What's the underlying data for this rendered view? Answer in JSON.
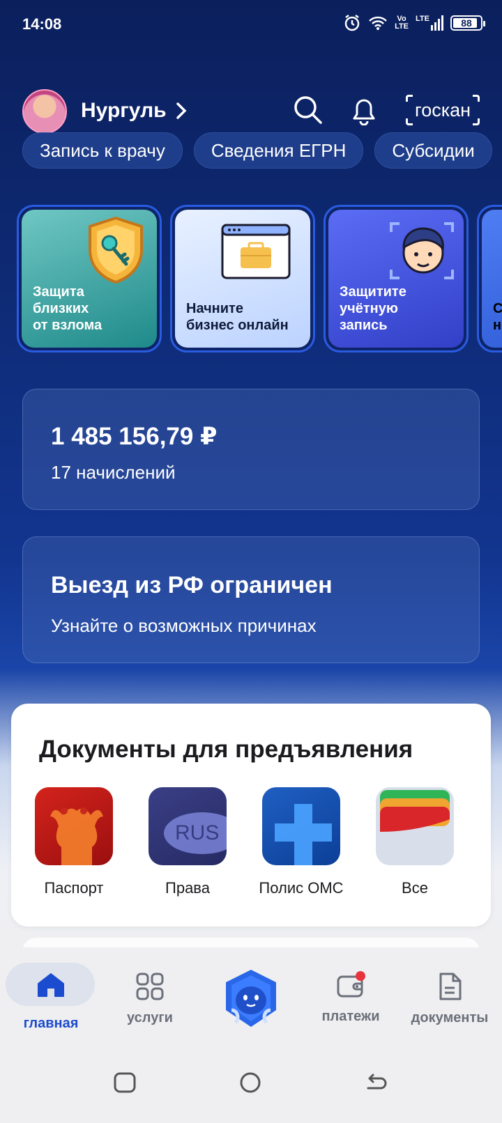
{
  "status_bar": {
    "time": "14:08",
    "net_label_1": "Vo\nLTE",
    "net_label_2": "LTE",
    "battery": "88"
  },
  "header": {
    "user_name": "Нургуль",
    "scan_label": "госкан"
  },
  "chips": [
    "Запись к врачу",
    "Сведения ЕГРН",
    "Субсидии"
  ],
  "stories": [
    {
      "text": "Защита\nблизких\nот взлома"
    },
    {
      "text": "Начните\nбизнес онлайн"
    },
    {
      "text": "Защитите\nучётную\nзапись"
    },
    {
      "text": "С\nн"
    }
  ],
  "balance": {
    "amount": "1 485 156,79 ₽",
    "count": "17 начислений"
  },
  "exit_card": {
    "title": "Выезд из РФ ограничен",
    "subtitle": "Узнайте о возможных причинах"
  },
  "documents": {
    "title": "Документы для предъявления",
    "items": [
      {
        "label": "Паспорт",
        "tile_text": ""
      },
      {
        "label": "Права",
        "tile_text": "RUS"
      },
      {
        "label": "Полис ОМС",
        "tile_text": ""
      },
      {
        "label": "Все",
        "tile_text": ""
      }
    ]
  },
  "bottom_nav": {
    "home": "главная",
    "services": "услуги",
    "payments": "платежи",
    "documents": "документы"
  },
  "colors": {
    "brand_blue": "#1b4ccf",
    "notification_red": "#e8333c"
  }
}
